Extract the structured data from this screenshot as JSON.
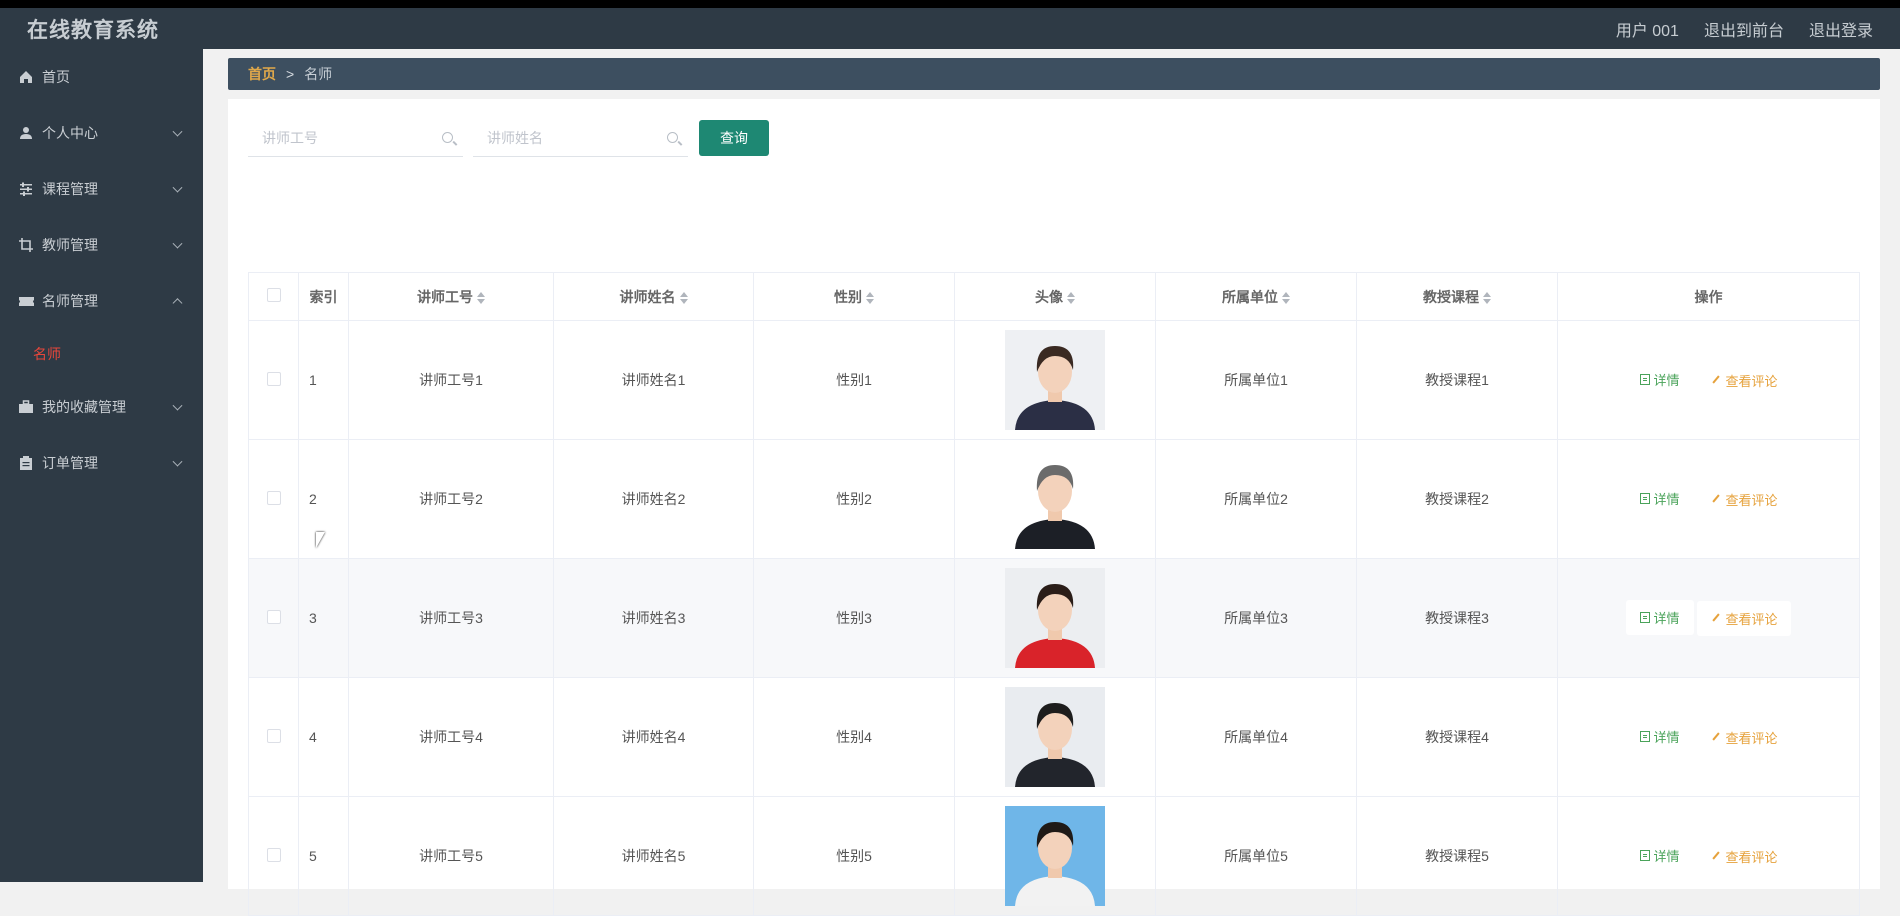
{
  "app": {
    "title": "在线教育系统"
  },
  "topbar": {
    "user": "用户 001",
    "back_front": "退出到前台",
    "logout": "退出登录"
  },
  "sidebar": {
    "items": [
      {
        "label": "首页",
        "icon": "home-icon"
      },
      {
        "label": "个人中心",
        "icon": "user-icon"
      },
      {
        "label": "课程管理",
        "icon": "sliders-icon"
      },
      {
        "label": "教师管理",
        "icon": "crop-icon"
      },
      {
        "label": "名师管理",
        "icon": "ticket-icon"
      },
      {
        "label": "我的收藏管理",
        "icon": "briefcase-icon"
      },
      {
        "label": "订单管理",
        "icon": "clipboard-icon"
      }
    ],
    "sub_active": "名师"
  },
  "breadcrumb": {
    "home": "首页",
    "sep": ">",
    "current": "名师"
  },
  "search": {
    "placeholder_id": "讲师工号",
    "placeholder_name": "讲师姓名",
    "button": "查询"
  },
  "table": {
    "headers": [
      "索引",
      "讲师工号",
      "讲师姓名",
      "性别",
      "头像",
      "所属单位",
      "教授课程",
      "操作"
    ],
    "rows": [
      {
        "idx": "1",
        "id": "讲师工号1",
        "name": "讲师姓名1",
        "gender": "性别1",
        "unit": "所属单位1",
        "course": "教授课程1"
      },
      {
        "idx": "2",
        "id": "讲师工号2",
        "name": "讲师姓名2",
        "gender": "性别2",
        "unit": "所属单位2",
        "course": "教授课程2"
      },
      {
        "idx": "3",
        "id": "讲师工号3",
        "name": "讲师姓名3",
        "gender": "性别3",
        "unit": "所属单位3",
        "course": "教授课程3"
      },
      {
        "idx": "4",
        "id": "讲师工号4",
        "name": "讲师姓名4",
        "gender": "性别4",
        "unit": "所属单位4",
        "course": "教授课程4"
      },
      {
        "idx": "5",
        "id": "讲师工号5",
        "name": "讲师姓名5",
        "gender": "性别5",
        "unit": "所属单位5",
        "course": "教授课程5"
      }
    ],
    "action_detail": "详情",
    "action_review": "查看评论"
  },
  "colors": {
    "topbar": "#2e3a45",
    "sidebar": "#2e3a45",
    "accent": "#1e8873",
    "active_sub": "#e8473b",
    "detail": "#4aa35a",
    "review": "#e6a23c"
  }
}
